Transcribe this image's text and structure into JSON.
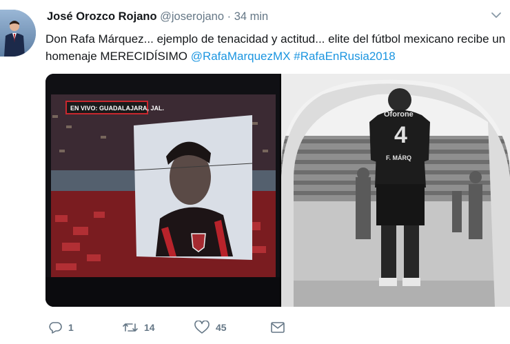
{
  "tweet": {
    "author_name": "José Orozco Rojano",
    "handle": "@joserojano",
    "separator": "·",
    "time": "34 min",
    "text_part1": "Don Rafa Márquez... ejemplo de tenacidad y actitud... elite del fútbol mexicano recibe un homenaje MERECIDÍSIMO ",
    "mention": "@RafaMarquezMX",
    "hashtag": "#RafaEnRusia2018"
  },
  "media": {
    "photo1": {
      "overlay_text": "EN VIVO: GUADALAJARA, JAL."
    },
    "photo2": {
      "jersey_brand": "Oforone",
      "jersey_number": "4",
      "jersey_name": "F. MÁRQ"
    }
  },
  "actions": {
    "reply_count": "1",
    "retweet_count": "14",
    "like_count": "45"
  },
  "colors": {
    "link": "#1b95e0",
    "muted": "#657786",
    "text": "#14171a"
  }
}
